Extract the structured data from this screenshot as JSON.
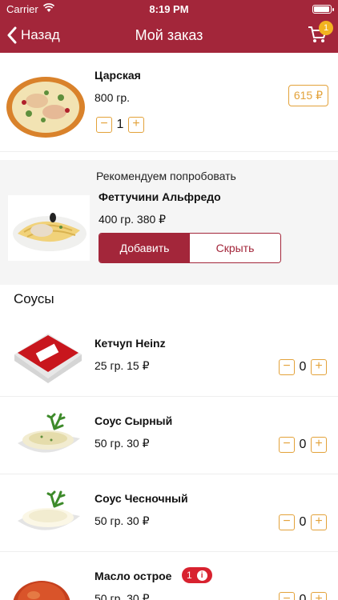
{
  "status_bar": {
    "carrier": "Carrier",
    "time": "8:19 PM"
  },
  "nav": {
    "back_label": "Назад",
    "title": "Мой заказ",
    "cart_count": "1"
  },
  "order_item": {
    "name": "Царская",
    "weight": "800 гр.",
    "price": "615 ₽",
    "quantity": "1"
  },
  "recommend": {
    "heading": "Рекомендуем попробовать",
    "name": "Феттучини Альфредо",
    "meta": "400 гр. 380 ₽",
    "add_label": "Добавить",
    "hide_label": "Скрыть"
  },
  "sauces_title": "Соусы",
  "sauces": [
    {
      "name": "Кетчуп Heinz",
      "meta": "25 гр. 15 ₽",
      "quantity": "0"
    },
    {
      "name": "Соус Сырный",
      "meta": "50 гр. 30 ₽",
      "quantity": "0"
    },
    {
      "name": "Соус Чесночный",
      "meta": "50 гр. 30 ₽",
      "quantity": "0"
    },
    {
      "name": "Масло острое",
      "meta": "50 гр. 30 ₽",
      "quantity": "0",
      "badge": "1"
    }
  ],
  "colors": {
    "brand": "#a3263a",
    "accent": "#e3a23a",
    "badge": "#f2b320",
    "alert": "#d8222f"
  }
}
